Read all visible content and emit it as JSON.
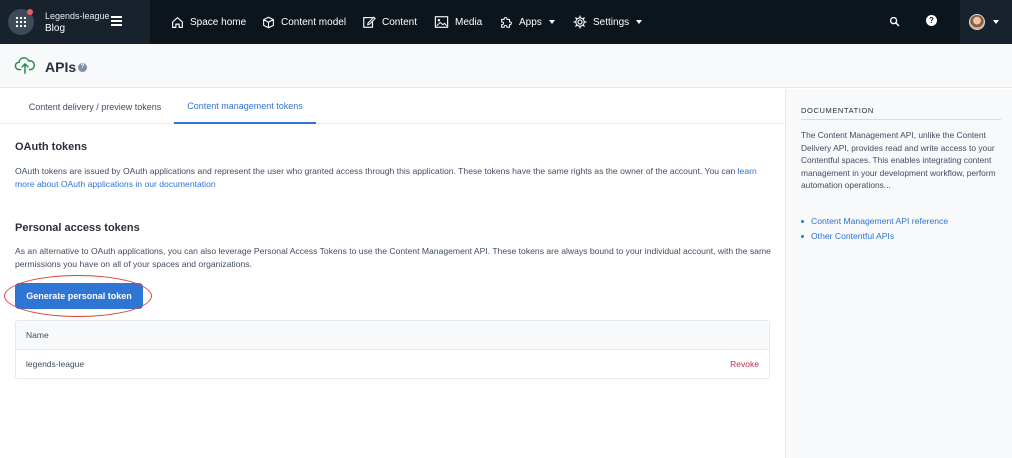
{
  "topbar": {
    "org_name": "Legends-league",
    "space_name": "Blog",
    "nav": [
      {
        "label": "Space home",
        "icon": "home-icon"
      },
      {
        "label": "Content model",
        "icon": "cube-icon"
      },
      {
        "label": "Content",
        "icon": "edit-icon"
      },
      {
        "label": "Media",
        "icon": "image-icon"
      },
      {
        "label": "Apps",
        "icon": "puzzle-icon"
      },
      {
        "label": "Settings",
        "icon": "gear-icon"
      }
    ],
    "help_glyph": "?"
  },
  "header": {
    "title": "APIs",
    "help_glyph": "?"
  },
  "tabs": [
    {
      "label": "Content delivery / preview tokens",
      "active": false
    },
    {
      "label": "Content management tokens",
      "active": true
    }
  ],
  "oauth": {
    "title": "OAuth tokens",
    "body": "OAuth tokens are issued by OAuth applications and represent the user who granted access through this application. These tokens have the same rights as the owner of the account. You can ",
    "link": "learn more about OAuth applications in our documentation"
  },
  "pat": {
    "title": "Personal access tokens",
    "body": "As an alternative to OAuth applications, you can also leverage Personal Access Tokens to use the Content Management API. These tokens are always bound to your individual account, with the same permissions you have on all of your spaces and organizations.",
    "button": "Generate personal token"
  },
  "tokens_table": {
    "header": "Name",
    "rows": [
      {
        "name": "legends-league",
        "action": "Revoke"
      }
    ]
  },
  "sidebar": {
    "title": "DOCUMENTATION",
    "text": "The Content Management API, unlike the Content Delivery API, provides read and write access to your Contentful spaces. This enables integrating content management in your development workflow, perform automation operations...",
    "links": [
      "Content Management API reference",
      "Other Contentful APIs"
    ]
  },
  "colors": {
    "accent": "#2e75d4",
    "topbar": "#0c141c",
    "danger": "#bf3045",
    "annotation": "#d9473a"
  }
}
